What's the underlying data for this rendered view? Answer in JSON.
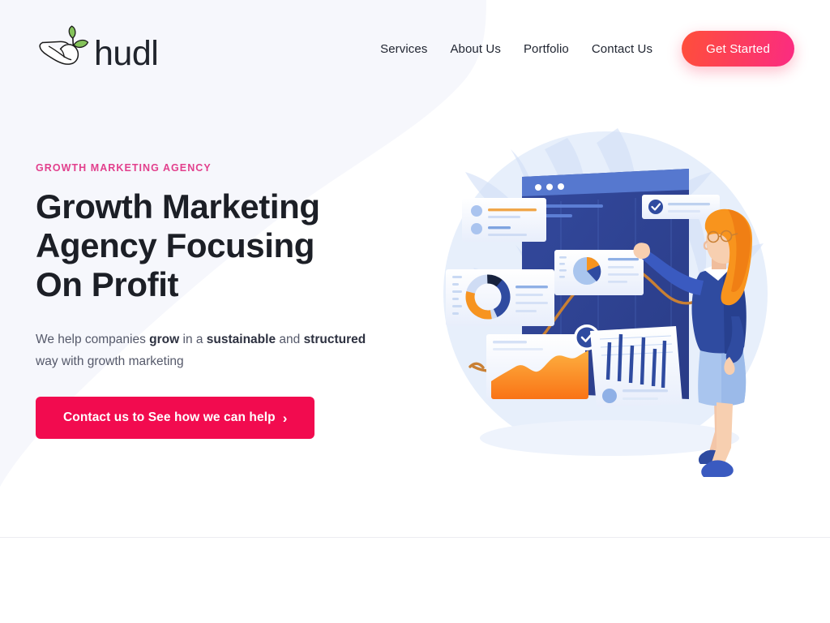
{
  "brand": {
    "name": "hudl",
    "logo_icon": "hand-sprout-icon",
    "leaf_color": "#7dbf54",
    "text_color": "#20242c"
  },
  "nav": {
    "items": [
      {
        "label": "Services",
        "name": "nav-link-services"
      },
      {
        "label": "About Us",
        "name": "nav-link-about-us"
      },
      {
        "label": "Portfolio",
        "name": "nav-link-portfolio"
      },
      {
        "label": "Contact Us",
        "name": "nav-link-contact-us"
      }
    ],
    "cta_label": "Get Started",
    "cta_gradient_from": "#ff4f3a",
    "cta_gradient_to": "#fb2b82"
  },
  "hero": {
    "eyebrow": "GROWTH MARKETING AGENCY",
    "eyebrow_color": "#e2408d",
    "title": "Growth Marketing Agency Focusing On Profit",
    "subtitle_parts": [
      {
        "text": "We help companies ",
        "bold": false
      },
      {
        "text": "grow",
        "bold": true
      },
      {
        "text": " in a ",
        "bold": false
      },
      {
        "text": "sustainable",
        "bold": true
      },
      {
        "text": " and ",
        "bold": false
      },
      {
        "text": "structured",
        "bold": true
      },
      {
        "text": " way with growth marketing",
        "bold": false
      }
    ],
    "subtitle_plain": "We help companies grow in a sustainable and structured way with growth marketing",
    "cta_label": "Contact us to See how we can help",
    "cta_chevron": "›",
    "cta_color": "#f20b4f",
    "illustration": {
      "name": "marketing-analytics-illustration",
      "description": "Woman with orange hair pointing at a dashboard of charts",
      "background_circle_color": "#e4edfb",
      "dashboard_color": "#2f4ba0",
      "accent_orange": "#f79420",
      "accent_blue": "#4c6fc7"
    }
  },
  "page": {
    "background_color": "#ffffff",
    "blob_color": "#f6f7fc",
    "divider_color": "#ececf1"
  }
}
